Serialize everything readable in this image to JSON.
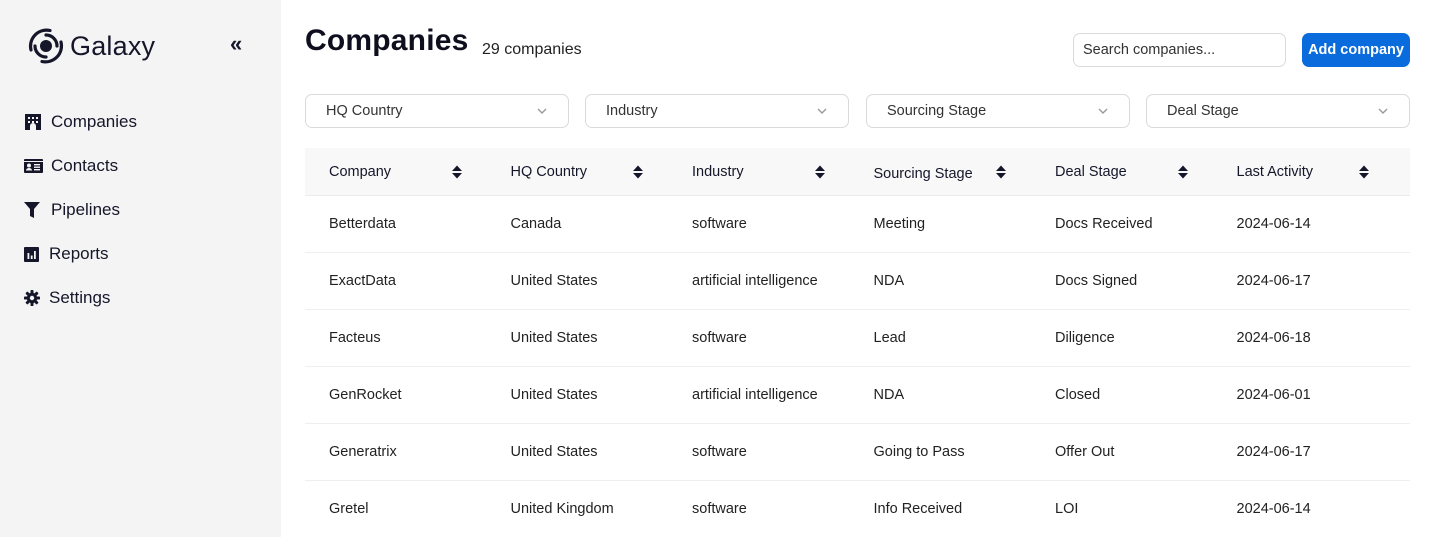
{
  "app": {
    "name": "Galaxy",
    "collapse_label": "«"
  },
  "sidebar": {
    "items": [
      {
        "label": "Companies",
        "icon": "building-icon"
      },
      {
        "label": "Contacts",
        "icon": "id-card-icon"
      },
      {
        "label": "Pipelines",
        "icon": "filter-icon"
      },
      {
        "label": "Reports",
        "icon": "chart-icon"
      },
      {
        "label": "Settings",
        "icon": "gear-icon"
      }
    ]
  },
  "header": {
    "title": "Companies",
    "count": "29 companies",
    "search_placeholder": "Search companies...",
    "search_value": "",
    "add_button": "Add company",
    "accent": "#0a6cdc"
  },
  "filters": [
    {
      "label": "HQ Country"
    },
    {
      "label": "Industry"
    },
    {
      "label": "Sourcing Stage"
    },
    {
      "label": "Deal Stage"
    }
  ],
  "table": {
    "columns": [
      "Company",
      "HQ Country",
      "Industry",
      "Sourcing Stage",
      "Deal Stage",
      "Last Activity"
    ],
    "rows": [
      [
        "Betterdata",
        "Canada",
        "software",
        "Meeting",
        "Docs Received",
        "2024-06-14"
      ],
      [
        "ExactData",
        "United States",
        "artificial intelligence",
        "NDA",
        "Docs Signed",
        "2024-06-17"
      ],
      [
        "Facteus",
        "United States",
        "software",
        "Lead",
        "Diligence",
        "2024-06-18"
      ],
      [
        "GenRocket",
        "United States",
        "artificial intelligence",
        "NDA",
        "Closed",
        "2024-06-01"
      ],
      [
        "Generatrix",
        "United States",
        "software",
        "Going to Pass",
        "Offer Out",
        "2024-06-17"
      ],
      [
        "Gretel",
        "United Kingdom",
        "software",
        "Info Received",
        "LOI",
        "2024-06-14"
      ]
    ]
  }
}
